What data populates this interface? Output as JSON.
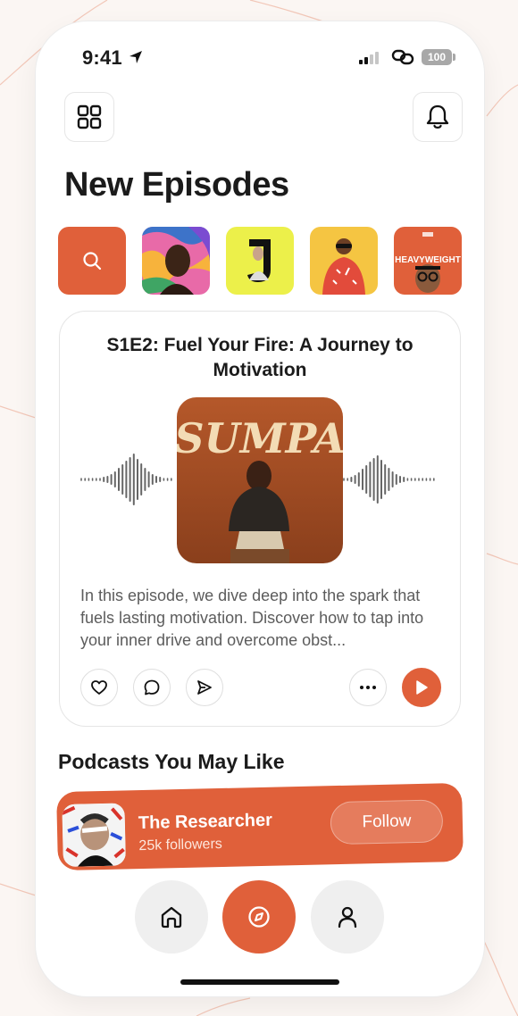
{
  "status_bar": {
    "time": "9:41",
    "battery": "100",
    "icons": [
      "location-arrow-icon",
      "signal-icon",
      "link-icon",
      "battery-icon"
    ]
  },
  "header": {
    "menu_icon": "grid-icon",
    "bell_icon": "bell-icon",
    "title": "New Episodes"
  },
  "thumbnails": [
    {
      "name": "search",
      "icon": "search-icon"
    },
    {
      "name": "podcast-cover-1"
    },
    {
      "name": "podcast-cover-2"
    },
    {
      "name": "podcast-cover-3"
    },
    {
      "name": "podcast-cover-4",
      "label": "HEAVYWEIGHT"
    }
  ],
  "episode": {
    "title": "S1E2: Fuel Your Fire: A Journey to Motivation",
    "cover_art_text": "SUMPA",
    "description": "In this episode, we dive deep into the spark that fuels lasting motivation. Discover how to tap into your inner drive and overcome obst...",
    "actions": [
      "heart-icon",
      "comment-icon",
      "send-icon",
      "more-icon",
      "play-icon"
    ]
  },
  "recommendations": {
    "title": "Podcasts You May Like",
    "podcast": {
      "name": "The Researcher",
      "followers": "25k followers",
      "follow_label": "Follow"
    }
  },
  "bottom_nav": [
    "home-icon",
    "compass-icon",
    "user-icon"
  ],
  "colors": {
    "accent": "#e0603a",
    "background": "#ffffff",
    "muted_text": "#5c5c5c"
  }
}
